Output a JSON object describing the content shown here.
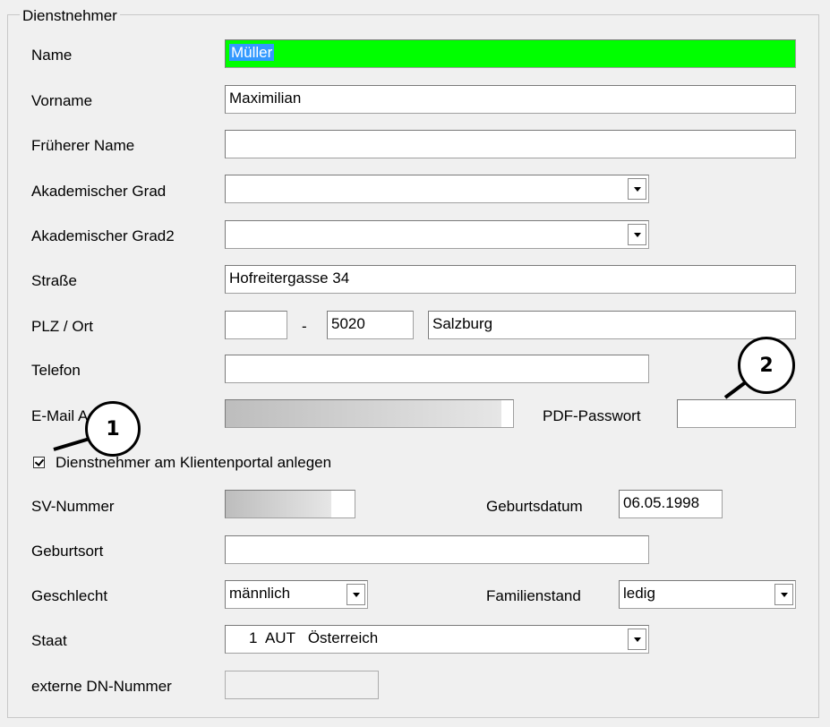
{
  "group": {
    "title": "Dienstnehmer"
  },
  "name": {
    "label": "Name",
    "value": "Müller"
  },
  "vorname": {
    "label": "Vorname",
    "value": "Maximilian"
  },
  "frueherer_name": {
    "label": "Früherer Name",
    "value": ""
  },
  "akad_grad": {
    "label": "Akademischer Grad",
    "value": ""
  },
  "akad_grad2": {
    "label": "Akademischer Grad2",
    "value": ""
  },
  "strasse": {
    "label": "Straße",
    "value": "Hofreitergasse 34"
  },
  "plz_ort": {
    "label": "PLZ / Ort",
    "country_prefix": "",
    "separator": "-",
    "plz": "5020",
    "ort": "Salzburg"
  },
  "telefon": {
    "label": "Telefon",
    "value": ""
  },
  "email": {
    "label": "E-Mail Adresse",
    "value": ""
  },
  "pdf_passwort": {
    "label": "PDF-Passwort",
    "value": ""
  },
  "klientenportal": {
    "label": "Dienstnehmer am Klientenportal anlegen",
    "checked": true
  },
  "sv_nummer": {
    "label": "SV-Nummer",
    "value": ""
  },
  "geburtsdatum": {
    "label": "Geburtsdatum",
    "value": "06.05.1998"
  },
  "geburtsort": {
    "label": "Geburtsort",
    "value": ""
  },
  "geschlecht": {
    "label": "Geschlecht",
    "value": "männlich"
  },
  "familienstand": {
    "label": "Familienstand",
    "value": "ledig"
  },
  "staat": {
    "label": "Staat",
    "value": "1  AUT   Österreich"
  },
  "externe_dn": {
    "label": "externe DN-Nummer",
    "value": ""
  },
  "callouts": [
    {
      "number": "1"
    },
    {
      "number": "2"
    }
  ],
  "colors": {
    "name_highlight": "#00ff00",
    "selection": "#3399ff",
    "panel": "#f0f0f0"
  }
}
